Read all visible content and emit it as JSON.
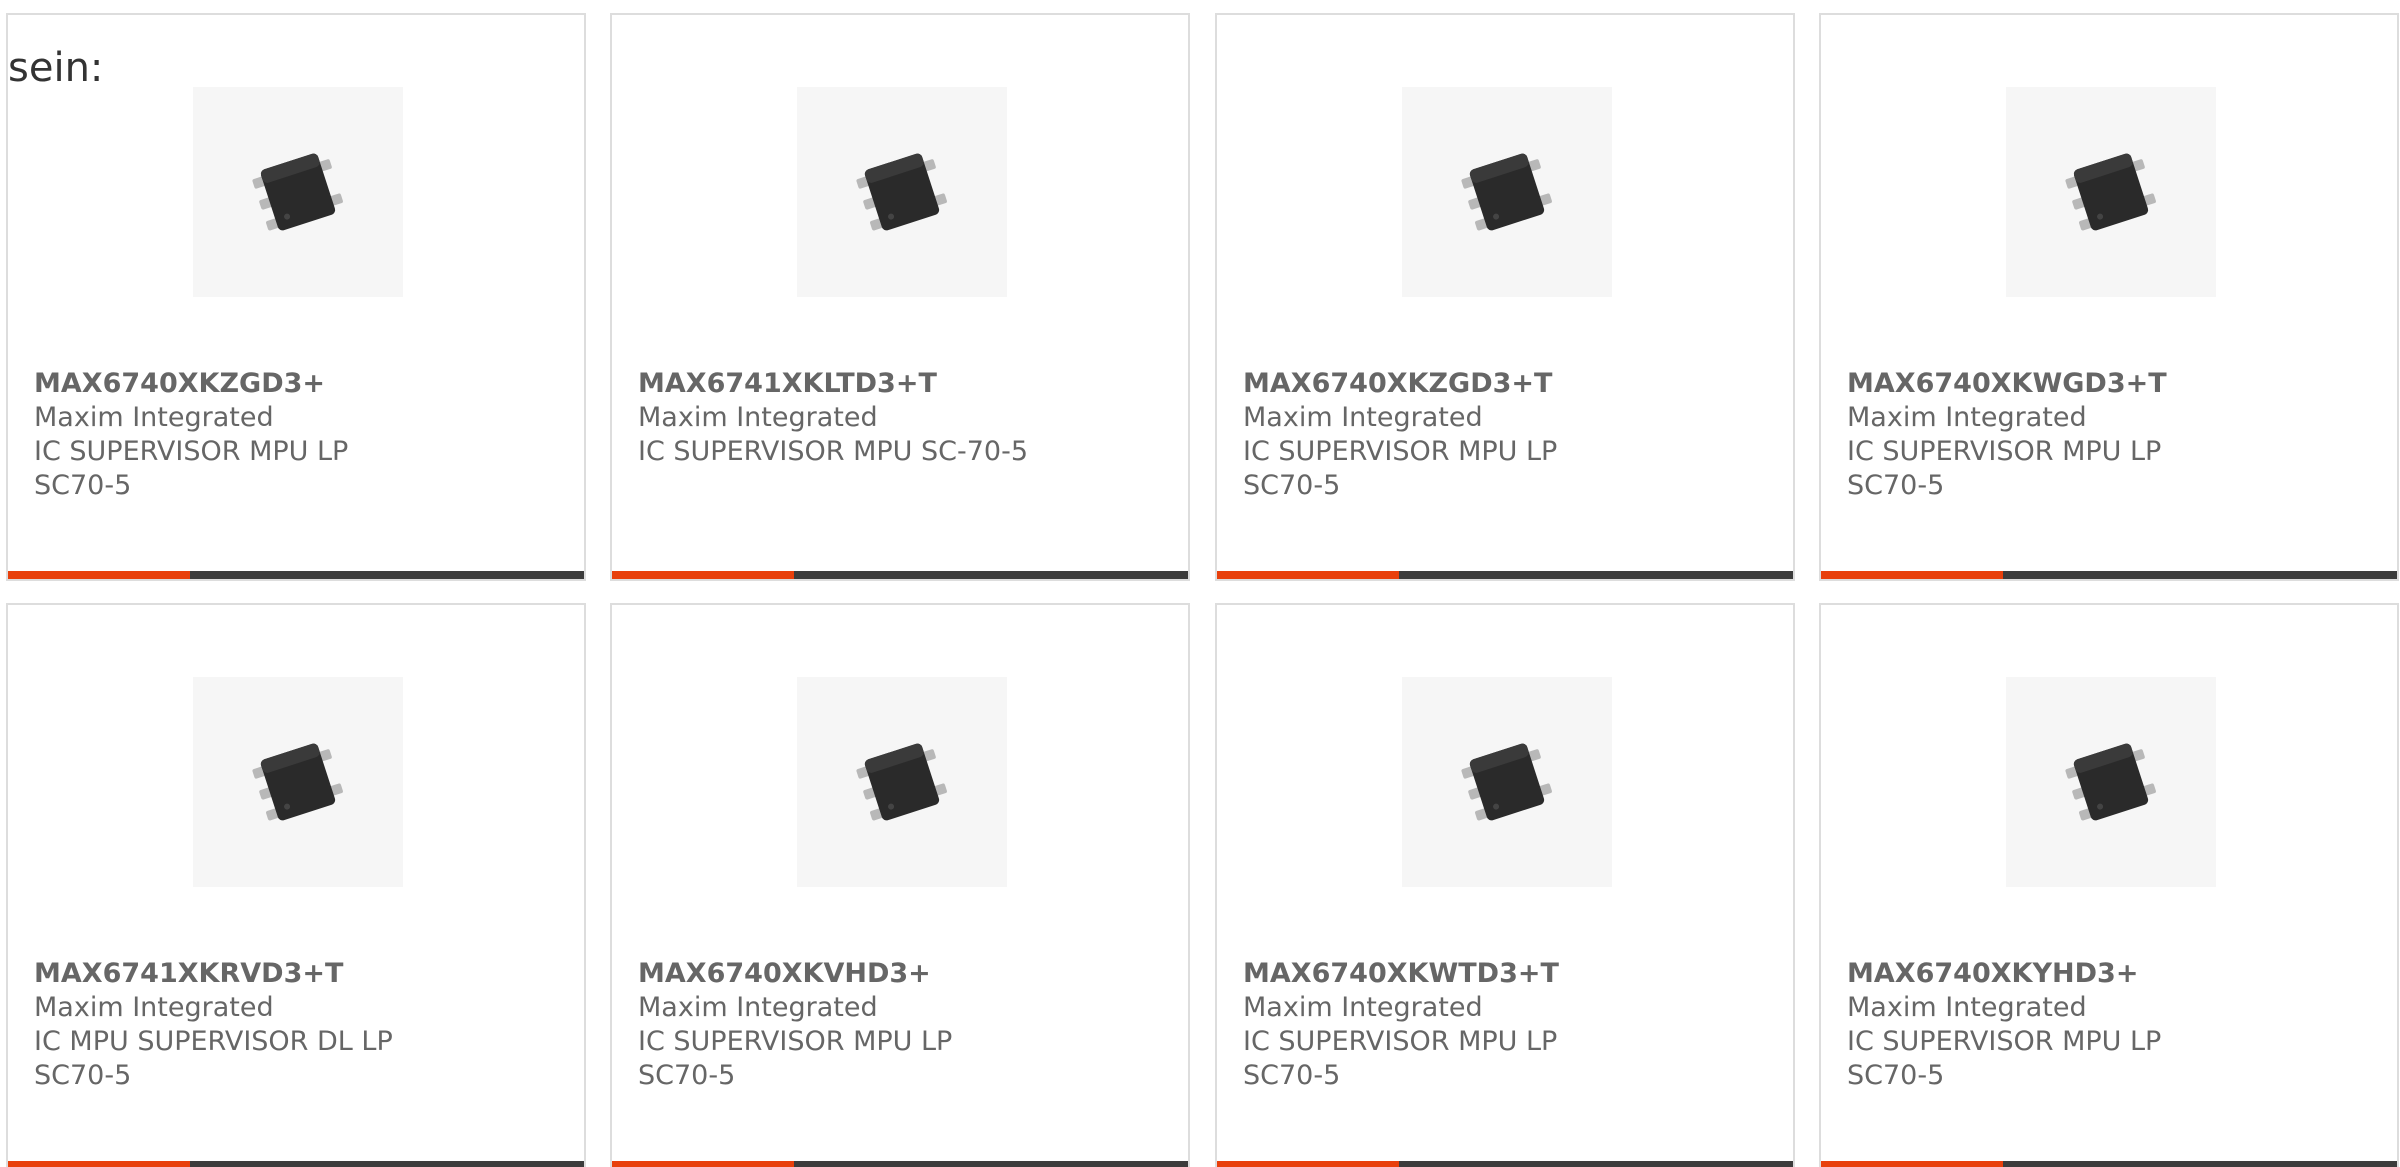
{
  "intro_label": "sein:",
  "colors": {
    "accent": "#e8400c",
    "bar_dark": "#3c3c3c",
    "text": "#666666",
    "border": "#dddddd"
  },
  "products": [
    {
      "part_number": "MAX6740XKZGD3+",
      "manufacturer": "Maxim Integrated",
      "description": "IC SUPERVISOR MPU LP SC70-5",
      "icon": "chip-sc70-icon"
    },
    {
      "part_number": "MAX6741XKLTD3+T",
      "manufacturer": "Maxim Integrated",
      "description": "IC SUPERVISOR MPU SC-70-5",
      "icon": "chip-sc70-icon"
    },
    {
      "part_number": "MAX6740XKZGD3+T",
      "manufacturer": "Maxim Integrated",
      "description": "IC SUPERVISOR MPU LP SC70-5",
      "icon": "chip-sc70-icon"
    },
    {
      "part_number": "MAX6740XKWGD3+T",
      "manufacturer": "Maxim Integrated",
      "description": "IC SUPERVISOR MPU LP SC70-5",
      "icon": "chip-sc70-icon"
    },
    {
      "part_number": "MAX6741XKRVD3+T",
      "manufacturer": "Maxim Integrated",
      "description": "IC MPU SUPERVISOR DL LP SC70-5",
      "icon": "chip-sc70-icon"
    },
    {
      "part_number": "MAX6740XKVHD3+",
      "manufacturer": "Maxim Integrated",
      "description": "IC SUPERVISOR MPU LP SC70-5",
      "icon": "chip-sc70-icon"
    },
    {
      "part_number": "MAX6740XKWTD3+T",
      "manufacturer": "Maxim Integrated",
      "description": "IC SUPERVISOR MPU LP SC70-5",
      "icon": "chip-sc70-icon"
    },
    {
      "part_number": "MAX6740XKYHD3+",
      "manufacturer": "Maxim Integrated",
      "description": "IC SUPERVISOR MPU LP SC70-5",
      "icon": "chip-sc70-icon"
    }
  ]
}
